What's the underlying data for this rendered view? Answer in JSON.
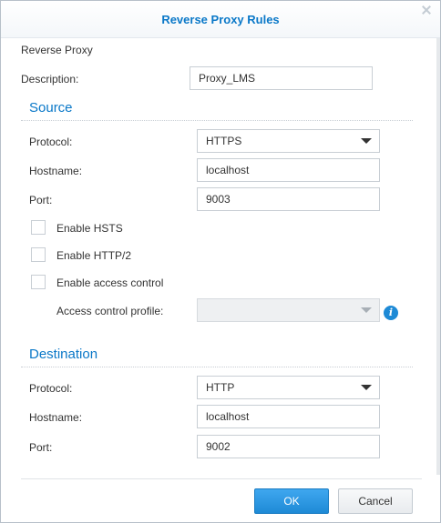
{
  "dialog": {
    "title": "Reverse Proxy Rules"
  },
  "general": {
    "heading": "Reverse Proxy",
    "description_label": "Description:",
    "description_value": "Proxy_LMS"
  },
  "source": {
    "title": "Source",
    "protocol_label": "Protocol:",
    "protocol_value": "HTTPS",
    "hostname_label": "Hostname:",
    "hostname_value": "localhost",
    "port_label": "Port:",
    "port_value": "9003",
    "hsts_label": "Enable HSTS",
    "hsts_checked": false,
    "http2_label": "Enable HTTP/2",
    "http2_checked": false,
    "access_control_label": "Enable access control",
    "access_control_checked": false,
    "access_profile_label": "Access control profile:",
    "access_profile_value": ""
  },
  "destination": {
    "title": "Destination",
    "protocol_label": "Protocol:",
    "protocol_value": "HTTP",
    "hostname_label": "Hostname:",
    "hostname_value": "localhost",
    "port_label": "Port:",
    "port_value": "9002"
  },
  "footer": {
    "ok_label": "OK",
    "cancel_label": "Cancel"
  },
  "colors": {
    "accent": "#0a78c8",
    "primary_button": "#1e8ad6",
    "border": "#c8ced4"
  },
  "icons": {
    "info": "info-icon",
    "close": "close-icon",
    "dropdown": "chevron-down-icon"
  }
}
